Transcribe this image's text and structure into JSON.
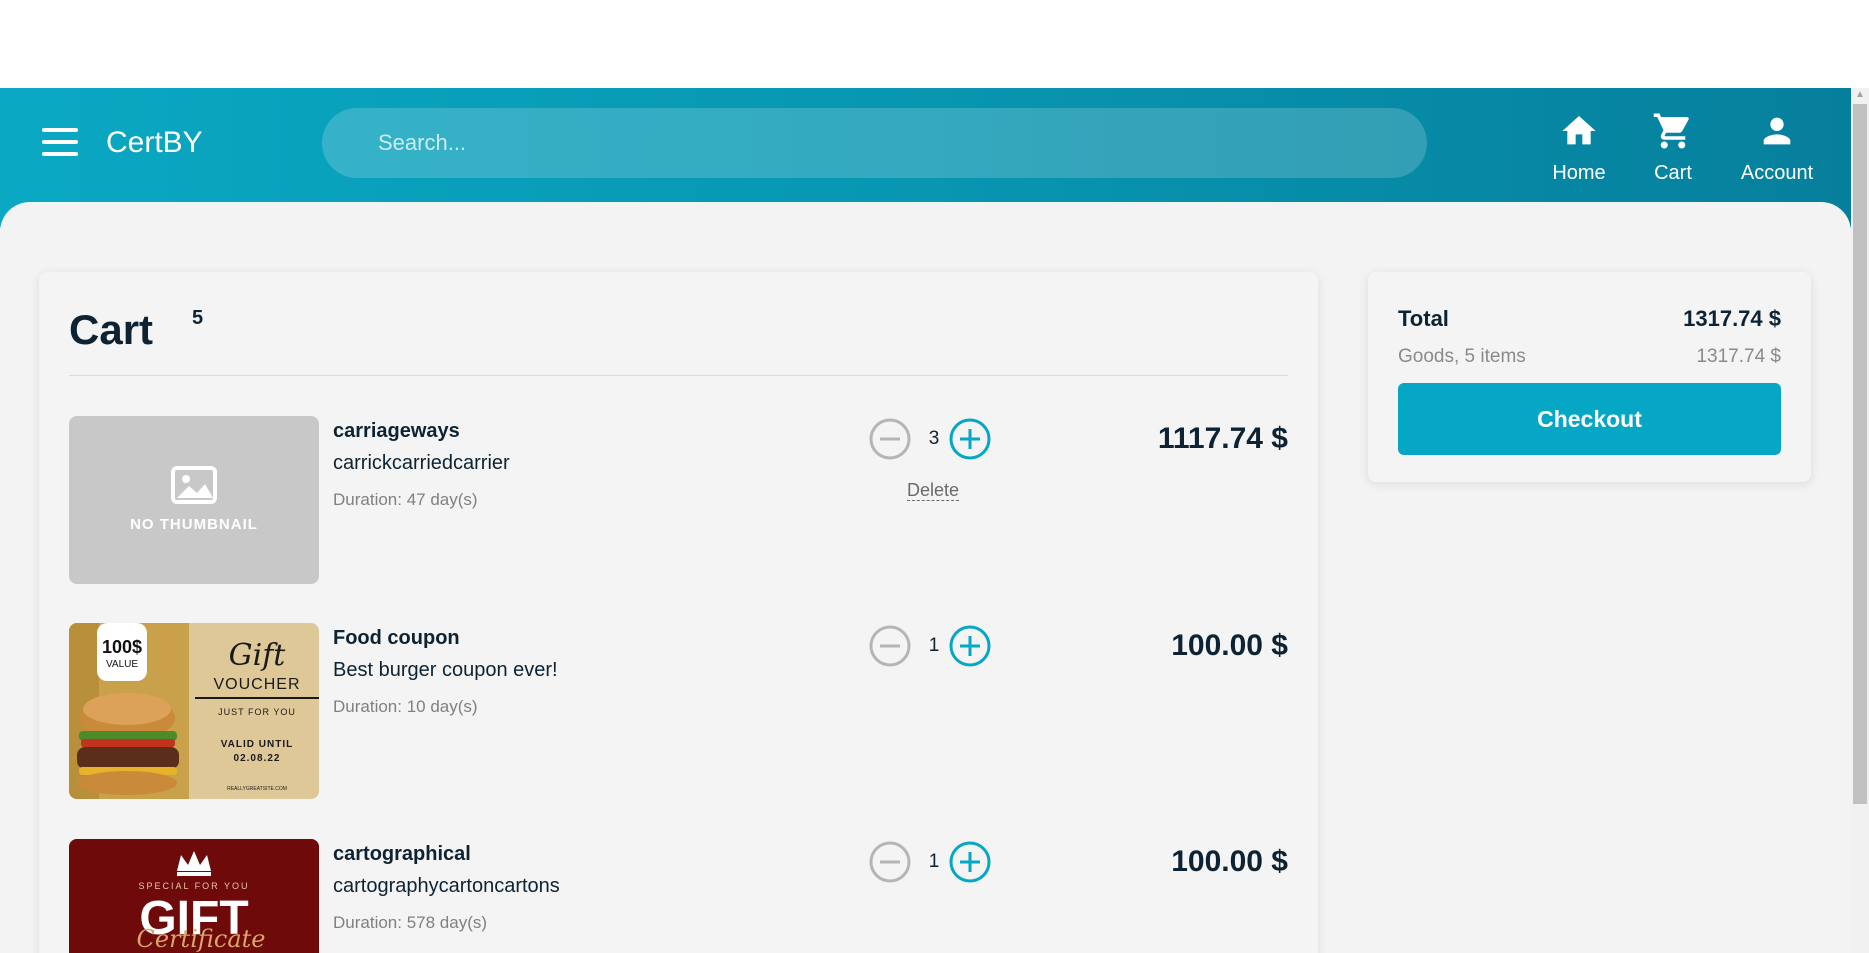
{
  "header": {
    "brand": "CertBY",
    "search_placeholder": "Search...",
    "nav": {
      "home": "Home",
      "cart": "Cart",
      "account": "Account"
    }
  },
  "cart": {
    "title": "Cart",
    "count": "5",
    "items": [
      {
        "name": "carriageways",
        "description": "carrickcarriedcarrier",
        "duration": "Duration: 47 day(s)",
        "quantity": "3",
        "price": "1117.74 $",
        "delete_label": "Delete",
        "thumbnail": {
          "type": "placeholder",
          "label": "NO THUMBNAIL"
        }
      },
      {
        "name": "Food coupon",
        "description": "Best burger coupon ever!",
        "duration": "Duration: 10 day(s)",
        "quantity": "1",
        "price": "100.00 $",
        "thumbnail": {
          "type": "gift-voucher",
          "value": "100$",
          "value_label": "VALUE",
          "title1": "Gift",
          "title2": "VOUCHER",
          "sub": "JUST FOR YOU",
          "valid1": "VALID UNTIL",
          "valid2": "02.08.22",
          "site": "REALLYGREATSITE.COM"
        }
      },
      {
        "name": "cartographical",
        "description": "cartographycartoncartons",
        "duration": "Duration: 578 day(s)",
        "quantity": "1",
        "price": "100.00 $",
        "thumbnail": {
          "type": "gift-certificate",
          "special": "SPECIAL FOR YOU",
          "title": "GIFT",
          "script": "Certificate"
        }
      }
    ]
  },
  "summary": {
    "total_label": "Total",
    "total_value": "1317.74 $",
    "goods_label": "Goods, 5 items",
    "goods_value": "1317.74 $",
    "checkout_label": "Checkout"
  },
  "colors": {
    "accent": "#06a7c4",
    "header_start": "#0aa8c3",
    "header_end": "#067f9c",
    "text_dark": "#0d2333"
  }
}
